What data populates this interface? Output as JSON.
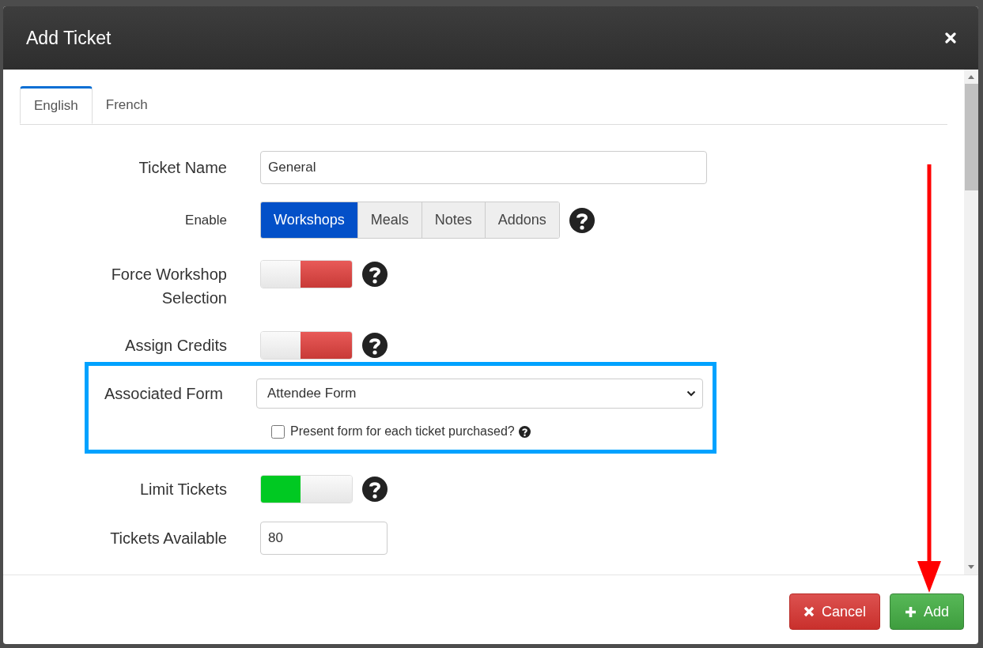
{
  "modal": {
    "title": "Add Ticket"
  },
  "tabs": [
    {
      "label": "English",
      "selected": true
    },
    {
      "label": "French",
      "selected": false
    }
  ],
  "fields": [
    {
      "kind": "text",
      "label": "Ticket Name",
      "value": "General"
    },
    {
      "kind": "segmented",
      "label": "Enable",
      "help": true,
      "options": [
        {
          "label": "Workshops",
          "selected": true
        },
        {
          "label": "Meals",
          "selected": false
        },
        {
          "label": "Notes",
          "selected": false
        },
        {
          "label": "Addons",
          "selected": false
        }
      ]
    },
    {
      "kind": "toggle",
      "label": "Force Workshop Selection",
      "on": false,
      "help": true
    },
    {
      "kind": "toggle",
      "label": "Assign Credits",
      "on": false,
      "help": true
    },
    {
      "kind": "select",
      "label": "Associated Form",
      "value": "Attendee Form",
      "highlighted": true,
      "checkbox": {
        "label": "Present form for each ticket purchased?",
        "checked": false,
        "help": true
      }
    },
    {
      "kind": "toggle",
      "label": "Limit Tickets",
      "on": true,
      "help": true
    },
    {
      "kind": "number",
      "label": "Tickets Available",
      "value": "80"
    }
  ],
  "buttons": [
    {
      "kind": "cancel",
      "label": "Cancel"
    },
    {
      "kind": "add",
      "label": "Add"
    }
  ]
}
